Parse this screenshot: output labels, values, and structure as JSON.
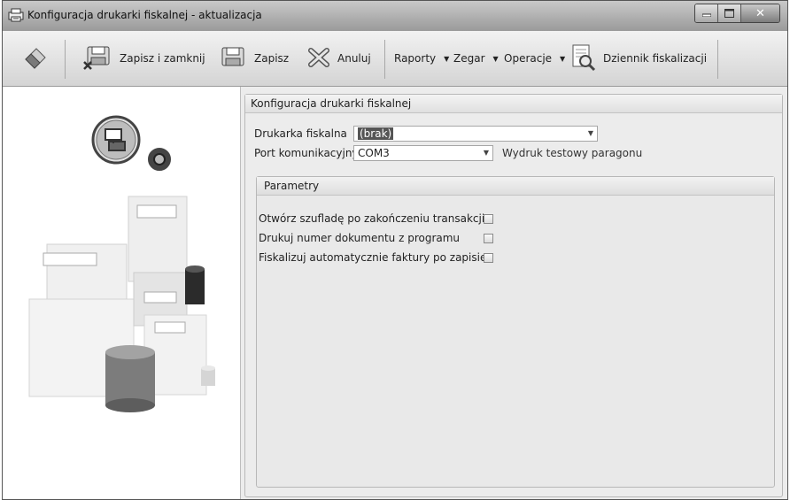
{
  "window": {
    "title": "Konfiguracja drukarki fiskalnej - aktualizacja",
    "icon": "printer-icon",
    "controls": {
      "minimize": "minimize-icon",
      "maximize": "maximize-icon",
      "close": "close-icon"
    }
  },
  "toolbar": {
    "save_close_label": "Zapisz i zamknij",
    "save_label": "Zapisz",
    "cancel_label": "Anuluj",
    "reports_label": "Raporty",
    "clock_label": "Zegar",
    "operations_label": "Operacje",
    "journal_label": "Dziennik fiskalizacji"
  },
  "config": {
    "group_title": "Konfiguracja drukarki fiskalnej",
    "printer_label": "Drukarka fiskalna",
    "printer_value": "(brak)",
    "port_label": "Port komunikacyjny",
    "port_value": "COM3",
    "test_print_link": "Wydruk testowy paragonu"
  },
  "params": {
    "title": "Parametry",
    "options": [
      {
        "label": "Otwórz szufladę po zakończeniu transakcji",
        "checked": false
      },
      {
        "label": "Drukuj numer dokumentu z programu",
        "checked": false
      },
      {
        "label": "Fiskalizuj automatycznie faktury po zapisie",
        "checked": false
      }
    ]
  }
}
